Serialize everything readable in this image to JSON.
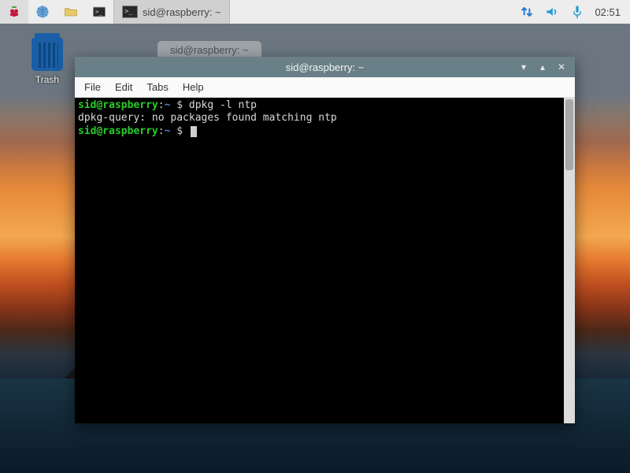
{
  "taskbar": {
    "task_title": "sid@raspberry: ~",
    "clock": "02:51"
  },
  "desktop": {
    "trash_label": "Trash"
  },
  "ghost": {
    "title": "sid@raspberry: ~"
  },
  "terminal": {
    "title": "sid@raspberry: ~",
    "menu": {
      "file": "File",
      "edit": "Edit",
      "tabs": "Tabs",
      "help": "Help"
    },
    "lines": {
      "p1_user": "sid@raspberry",
      "p1_sep": ":",
      "p1_path": "~",
      "p1_dollar": " $ ",
      "p1_cmd": "dpkg -l ntp",
      "out1": "dpkg-query: no packages found matching ntp",
      "p2_user": "sid@raspberry",
      "p2_sep": ":",
      "p2_path": "~",
      "p2_dollar": " $ "
    }
  }
}
